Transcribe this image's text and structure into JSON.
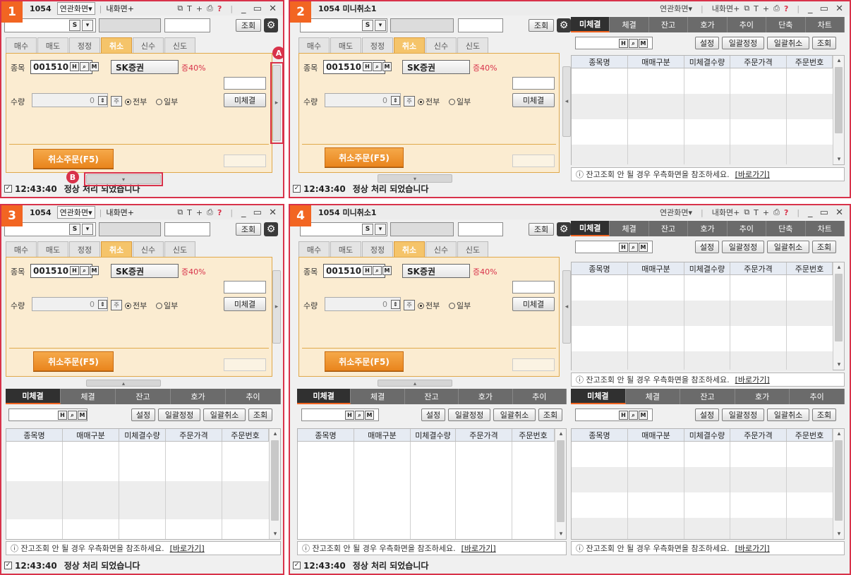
{
  "panels": [
    {
      "badge": "1"
    },
    {
      "badge": "2"
    },
    {
      "badge": "3"
    },
    {
      "badge": "4"
    }
  ],
  "titlebar": {
    "screen_no": "1054",
    "related_screens": "연관화면▾",
    "mini_title": "1054 미니취소1",
    "related_screens_2": "연관화면▾",
    "my_screen": "내화면+",
    "help": "?",
    "window_controls": "_ ▭ ✕"
  },
  "query": {
    "s_button": "S",
    "dropdown": "▾",
    "search_button": "조회"
  },
  "order_tabs": [
    "매수",
    "매도",
    "정정",
    "취소",
    "신수",
    "신도"
  ],
  "order_form": {
    "stock_label": "종목",
    "stock_code": "001510",
    "h_btn": "H",
    "q_btn": "Q",
    "m_btn": "M",
    "stock_name": "SK증권",
    "margin": "증40%",
    "qty_label": "수량",
    "qty_value": "0",
    "unit": "주",
    "all_option": "전부",
    "partial_option": "일부",
    "unfilled_button": "미체결",
    "cancel_order_button": "취소주문(F5)"
  },
  "lower_tabs": [
    "미체결",
    "체결",
    "잔고",
    "호가",
    "추이"
  ],
  "right_tabs": [
    "미체결",
    "체결",
    "잔고",
    "호가",
    "추이",
    "단축",
    "차트"
  ],
  "grid_controls": {
    "settings": "설정",
    "batch_modify": "일괄정정",
    "batch_cancel": "일괄취소",
    "search": "조회"
  },
  "grid_headers": [
    "종목명",
    "매매구분",
    "미체결수량",
    "주문가격",
    "주문번호"
  ],
  "info_bar": {
    "text": "ⓘ 잔고조회 안 될 경우 우측화면을 참조하세요.",
    "link": "[바로가기]"
  },
  "status_bar": {
    "time": "12:43:40",
    "message": "정상 처리 되었습니다"
  },
  "annotations": {
    "a": "A",
    "b": "B"
  },
  "colors": {
    "accent": "#f26522",
    "frame": "#d8324a",
    "tab_active": "#f5c46a",
    "order_bg": "#fbecd1"
  }
}
